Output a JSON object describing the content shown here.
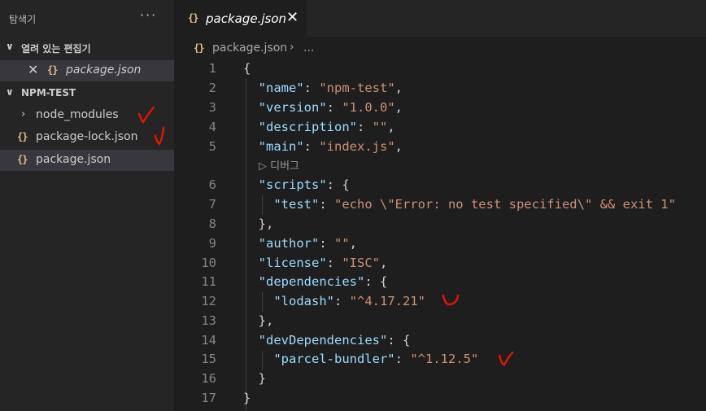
{
  "sidebar": {
    "title": "탐색기",
    "more": "···",
    "open_editors_header": "열려 있는 편집기",
    "open_editors": [
      {
        "name": "package.json",
        "close": "✕",
        "icon": "{}"
      }
    ],
    "folder_header": "NPM-TEST",
    "tree": [
      {
        "name": "node_modules",
        "type": "folder",
        "chevron": "›"
      },
      {
        "name": "package-lock.json",
        "type": "json",
        "icon": "{}"
      },
      {
        "name": "package.json",
        "type": "json",
        "icon": "{}",
        "selected": true
      }
    ]
  },
  "tab": {
    "icon": "{}",
    "label": "package.json",
    "close": "✕"
  },
  "breadcrumb": {
    "icon": "{}",
    "file": "package.json",
    "sep": "›",
    "more": "..."
  },
  "editor": {
    "codelens": "▷ 디버그",
    "line_numbers": [
      "1",
      "2",
      "3",
      "4",
      "5",
      "6",
      "7",
      "8",
      "9",
      "10",
      "11",
      "12",
      "13",
      "14",
      "15",
      "16",
      "17"
    ],
    "lines": [
      {
        "indent": 0,
        "key": "",
        "value": "",
        "raw": "{"
      },
      {
        "indent": 1,
        "key": "\"name\"",
        "value": "\"npm-test\"",
        "tail": ","
      },
      {
        "indent": 1,
        "key": "\"version\"",
        "value": "\"1.0.0\"",
        "tail": ","
      },
      {
        "indent": 1,
        "key": "\"description\"",
        "value": "\"\"",
        "tail": ","
      },
      {
        "indent": 1,
        "key": "\"main\"",
        "value": "\"index.js\"",
        "tail": ","
      },
      {
        "indent": 1,
        "key": "\"scripts\"",
        "value": "",
        "tail": "{"
      },
      {
        "indent": 2,
        "key": "\"test\"",
        "value": "\"echo \\\"Error: no test specified\\\" && exit 1\"",
        "tail": ""
      },
      {
        "indent": 1,
        "key": "",
        "value": "",
        "raw": "},"
      },
      {
        "indent": 1,
        "key": "\"author\"",
        "value": "\"\"",
        "tail": ","
      },
      {
        "indent": 1,
        "key": "\"license\"",
        "value": "\"ISC\"",
        "tail": ","
      },
      {
        "indent": 1,
        "key": "\"dependencies\"",
        "value": "",
        "tail": "{"
      },
      {
        "indent": 2,
        "key": "\"lodash\"",
        "value": "\"^4.17.21\"",
        "tail": ""
      },
      {
        "indent": 1,
        "key": "",
        "value": "",
        "raw": "},"
      },
      {
        "indent": 1,
        "key": "\"devDependencies\"",
        "value": "",
        "tail": "{"
      },
      {
        "indent": 2,
        "key": "\"parcel-bundler\"",
        "value": "\"^1.12.5\"",
        "tail": ""
      },
      {
        "indent": 1,
        "key": "",
        "value": "",
        "raw": "}"
      },
      {
        "indent": 0,
        "key": "",
        "value": "",
        "raw": "}"
      }
    ]
  },
  "colors": {
    "annotation": "#e51400",
    "json_icon": "#e2c08d",
    "key": "#9cdcfe",
    "string": "#ce9178"
  }
}
